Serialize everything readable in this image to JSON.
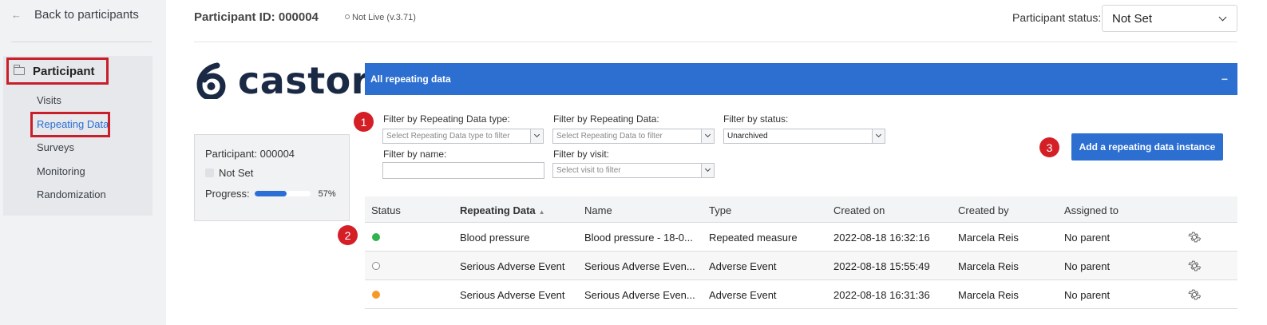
{
  "sidebar": {
    "back_label": "Back to participants",
    "participant_label": "Participant",
    "items": [
      {
        "label": "Visits"
      },
      {
        "label": "Repeating Data"
      },
      {
        "label": "Surveys"
      },
      {
        "label": "Monitoring"
      },
      {
        "label": "Randomization"
      }
    ]
  },
  "header": {
    "participant_id": "Participant ID: 000004",
    "live_state": "Not Live (v.3.71)",
    "status_label": "Participant status:",
    "status_value": "Not Set"
  },
  "logo": {
    "text": "castor"
  },
  "participant_card": {
    "id": "Participant: 000004",
    "status": "Not Set",
    "progress_label": "Progress:",
    "progress_percent": 57,
    "progress_text": "57%"
  },
  "panel": {
    "title": "All repeating data",
    "collapse_icon": "−"
  },
  "filters": {
    "type_label": "Filter by Repeating Data type:",
    "type_placeholder": "Select Repeating Data type to filter",
    "data_label": "Filter by Repeating Data:",
    "data_placeholder": "Select Repeating Data to filter",
    "status_label": "Filter by status:",
    "status_value": "Unarchived",
    "name_label": "Filter by name:",
    "name_value": "",
    "visit_label": "Filter by visit:",
    "visit_placeholder": "Select visit to filter"
  },
  "badges": {
    "one": "1",
    "two": "2",
    "three": "3"
  },
  "add_button": "Add a repeating data instance",
  "table": {
    "columns": [
      "Status",
      "Repeating Data",
      "Name",
      "Type",
      "Created on",
      "Created by",
      "Assigned to"
    ],
    "rows": [
      {
        "status_color": "#2fb34a",
        "repeating_data": "Blood pressure",
        "name": "Blood pressure - 18-0...",
        "type": "Repeated measure",
        "created_on": "2022-08-18 16:32:16",
        "created_by": "Marcela Reis",
        "assigned_to": "No parent"
      },
      {
        "status_color": "#ffffff",
        "repeating_data": "Serious Adverse Event",
        "name": "Serious Adverse Even...",
        "type": "Adverse Event",
        "created_on": "2022-08-18 15:55:49",
        "created_by": "Marcela Reis",
        "assigned_to": "No parent"
      },
      {
        "status_color": "#f59a2a",
        "repeating_data": "Serious Adverse Event",
        "name": "Serious Adverse Even...",
        "type": "Adverse Event",
        "created_on": "2022-08-18 16:31:36",
        "created_by": "Marcela Reis",
        "assigned_to": "No parent"
      }
    ]
  },
  "icons": {
    "back": "arrow-left-icon",
    "folder": "folder-icon",
    "gear": "gear-icon",
    "sort": "sort-asc-icon",
    "chevron": "chevron-down-icon"
  },
  "colors": {
    "accent": "#2c6fd1",
    "highlight": "#c8202a",
    "badge": "#d41f26"
  }
}
